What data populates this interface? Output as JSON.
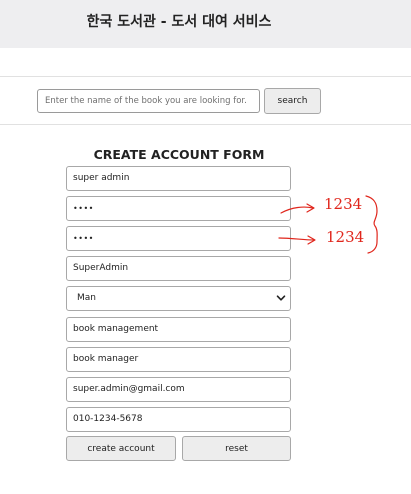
{
  "header": {
    "title": "한국 도서관 - 도서 대여 서비스"
  },
  "search": {
    "placeholder": "Enter the name of the book you are looking for.",
    "button_label": "search"
  },
  "form": {
    "title": "CREATE ACCOUNT FORM",
    "fields": {
      "user_name": "super admin",
      "password": "••••",
      "password_confirm": "••••",
      "nickname": "SuperAdmin",
      "gender": "Man",
      "department": "book management",
      "position": "book manager",
      "email": "super.admin@gmail.com",
      "phone": "010-1234-5678"
    },
    "create_label": "create account",
    "reset_label": "reset"
  },
  "annotations": {
    "password_note": "1234",
    "confirm_note": "1234",
    "color": "#e0261c"
  }
}
